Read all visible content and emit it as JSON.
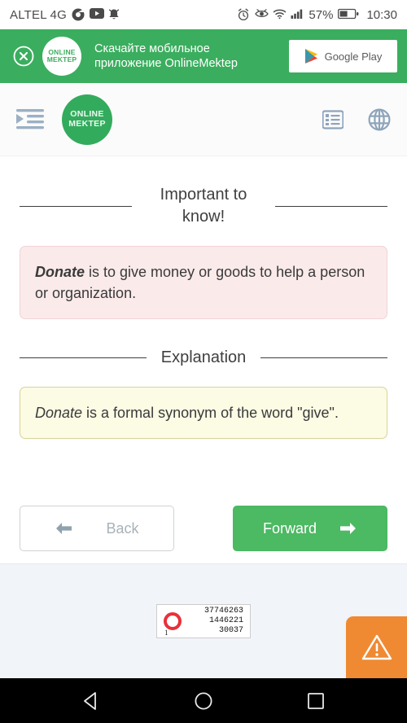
{
  "status_bar": {
    "carrier": "ALTEL 4G",
    "left_icons": [
      "chrome-icon",
      "youtube-icon",
      "bell-icon"
    ],
    "right_icons": [
      "alarm-icon",
      "eye-comfort-icon",
      "wifi-icon",
      "signal-icon"
    ],
    "battery_percent": "57%",
    "time": "10:30"
  },
  "promo_banner": {
    "close_label": "close-icon",
    "logo_line1": "ONLINE",
    "logo_line2": "MEKTEP",
    "text_line1": "Скачайте мобильное",
    "text_line2": "приложение OnlineMektep",
    "store_button": "Google Play",
    "background_color": "#3aae5e"
  },
  "app_header": {
    "menu_icon": "indent-menu-icon",
    "logo_line1": "ONLINE",
    "logo_line2": "MEKTEP",
    "list_icon": "list-view-icon",
    "globe_icon": "language-globe-icon",
    "logo_color": "#33ab5d"
  },
  "lesson": {
    "sections": [
      {
        "heading": "Important to know!",
        "box_style": "pink",
        "box_color": "#fbeaea",
        "term": "Donate",
        "rest": " is to give money or goods to help a person or organization."
      },
      {
        "heading": "Explanation",
        "box_style": "yellow",
        "box_color": "#fcfbe4",
        "term": "Donate",
        "rest": " is a formal synonym of the word \"give\"."
      }
    ],
    "back_button": "Back",
    "forward_button": "Forward",
    "back_arrow": "arrow-left-icon",
    "forward_arrow": "arrow-right-icon",
    "forward_color": "#4cb963"
  },
  "footer": {
    "counter": {
      "index": "1",
      "values": [
        "37746263",
        "1446221",
        "30037"
      ],
      "ring_color": "#e8313a"
    },
    "warning_button": {
      "icon": "warning-triangle-icon",
      "color": "#ef8a33"
    }
  },
  "android_nav": {
    "back": "nav-back-icon",
    "home": "nav-home-icon",
    "recents": "nav-recents-icon"
  }
}
